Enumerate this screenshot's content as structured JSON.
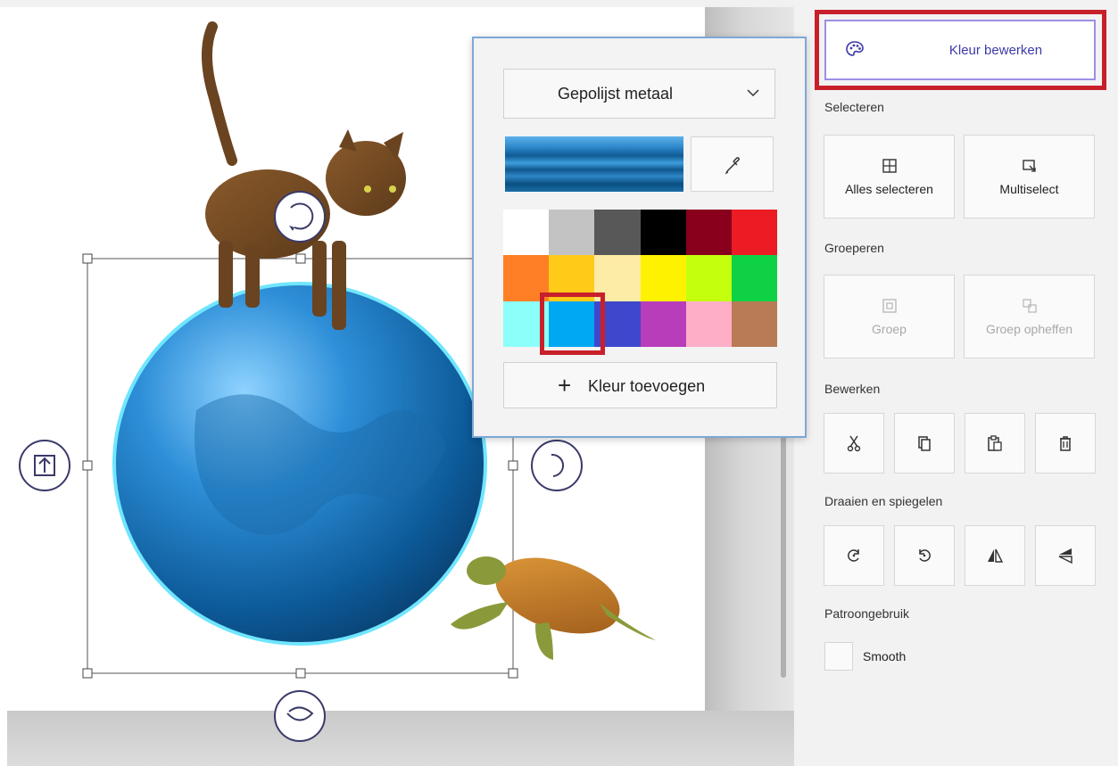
{
  "panel": {
    "edit_color": "Kleur bewerken",
    "sections": {
      "select": "Selecteren",
      "group": "Groeperen",
      "edit": "Bewerken",
      "rotate": "Draaien en spiegelen",
      "pattern": "Patroongebruik"
    },
    "select_all": "Alles selecteren",
    "multiselect": "Multiselect",
    "group_btn": "Groep",
    "ungroup_btn": "Groep opheffen",
    "smooth": "Smooth"
  },
  "popup": {
    "material": "Gepolijst metaal",
    "add_color": "Kleur toevoegen",
    "palette": [
      "#ffffff",
      "#c3c3c3",
      "#585858",
      "#000000",
      "#88001b",
      "#ec1c24",
      "#ff7f27",
      "#ffca18",
      "#fdeca6",
      "#fff200",
      "#c4ff0e",
      "#0ed145",
      "#8cfffb",
      "#00a8f3",
      "#3f48cc",
      "#b83dba",
      "#ffaec8",
      "#b97a56"
    ],
    "selected_color": "#00a8f3"
  },
  "icons": {
    "edit_color": "palette-icon",
    "eyedropper": "eyedropper-icon"
  }
}
